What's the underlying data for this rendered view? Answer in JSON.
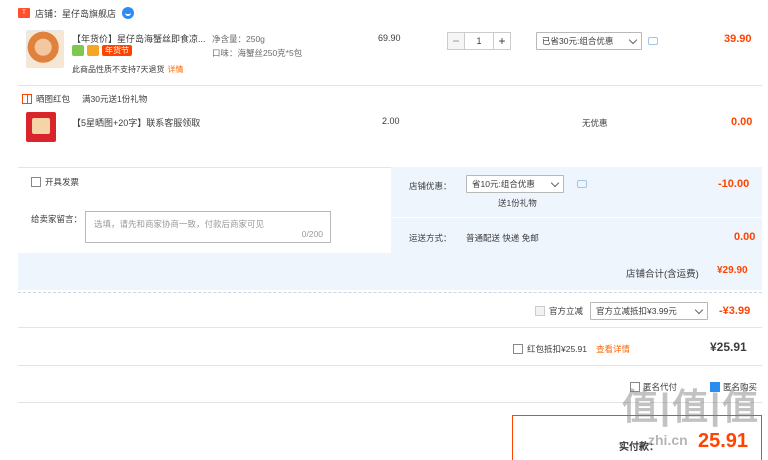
{
  "shop": {
    "label": "店铺：",
    "name": "星仔岛旗舰店"
  },
  "item1": {
    "title": "【年货价】星仔岛海蟹丝即食凉...",
    "badge": "年货节",
    "notice": "此商品性质不支持7天退货",
    "notice_link": "详情",
    "spec1": "净含量：250g",
    "spec2": "口味：海蟹丝250克*5包",
    "price": "69.90",
    "qty": "1",
    "discount": "已省30元:组合优惠",
    "total": "39.90"
  },
  "gift": {
    "label": "晒图红包",
    "desc": "满30元送1份礼物",
    "title": "【5星晒图+20字】联系客服领取",
    "price": "2.00",
    "discount": "无优惠",
    "total": "0.00"
  },
  "order": {
    "invoice_label": "开具发票",
    "message_label": "给卖家留言：",
    "message_placeholder": "选填，请先和商家协商一致，付款后商家可见",
    "message_count": "0/200",
    "shop_discount_label": "店铺优惠：",
    "shop_discount_value": "省10元:组合优惠",
    "shop_discount_note": "送1份礼物",
    "shop_discount_amount": "-10.00",
    "shipping_label": "运送方式：",
    "shipping_value": "普通配送 快递 免邮",
    "shipping_amount": "0.00",
    "shop_total_label": "店铺合计(含运费)",
    "shop_total": "¥29.90"
  },
  "official": {
    "label": "官方立减",
    "select": "官方立减抵扣¥3.99元",
    "amount": "-¥3.99"
  },
  "redpacket": {
    "label": "红包抵扣¥25.91",
    "link": "查看详情",
    "amount": "¥25.91"
  },
  "footer": {
    "anon": "匿名代付",
    "other": "匿名购买",
    "pay_label": "实付款：",
    "pay_amount": "25.91",
    "watermark": "值|值|值",
    "watermark_site": "zhi.cn"
  },
  "colors": {
    "accent": "#ff4400",
    "blue_panel": "#eef5fd"
  }
}
